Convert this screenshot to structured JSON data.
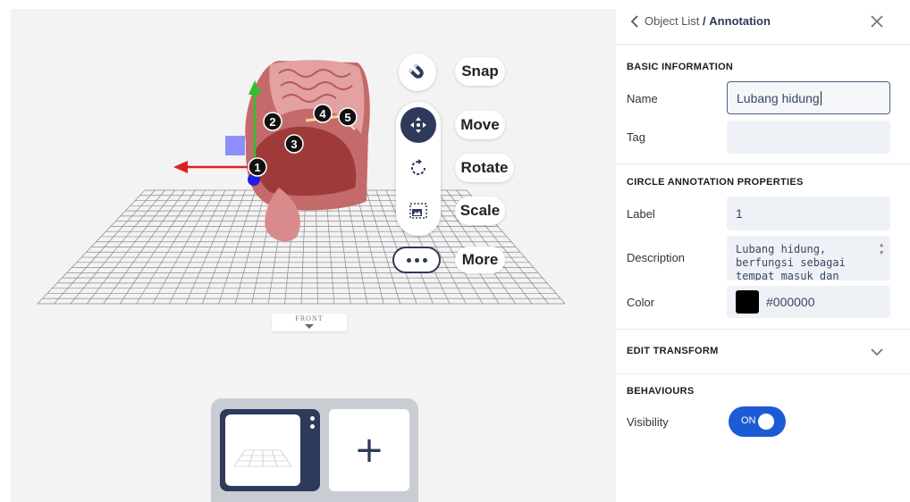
{
  "viewport": {
    "tools": {
      "snap_label": "Snap",
      "move_label": "Move",
      "rotate_label": "Rotate",
      "scale_label": "Scale",
      "more_label": "More",
      "active_tool": "Move"
    },
    "annotation_markers": [
      "1",
      "2",
      "3",
      "4",
      "5"
    ],
    "view_label": "FRONT",
    "thumbnail_add": "+"
  },
  "panel": {
    "breadcrumb_parent": "Object List",
    "breadcrumb_separator": "/",
    "breadcrumb_current": "Annotation",
    "basic_info": {
      "title": "BASIC INFORMATION",
      "name_label": "Name",
      "name_value": "Lubang hidung",
      "tag_label": "Tag",
      "tag_value": ""
    },
    "circle_props": {
      "title": "CIRCLE ANNOTATION PROPERTIES",
      "label_label": "Label",
      "label_value": "1",
      "description_label": "Description",
      "description_value": "Lubang hidung,\nberfungsi sebagai\ntempat masuk dan",
      "color_label": "Color",
      "color_value": "#000000"
    },
    "edit_transform": {
      "title": "EDIT TRANSFORM"
    },
    "behaviours": {
      "title": "BEHAVIOURS",
      "visibility_label": "Visibility",
      "visibility_state": "ON"
    }
  },
  "colors": {
    "accent": "#1d5bd6",
    "navy": "#2d3a5a",
    "field_bg": "#eef1f6"
  }
}
